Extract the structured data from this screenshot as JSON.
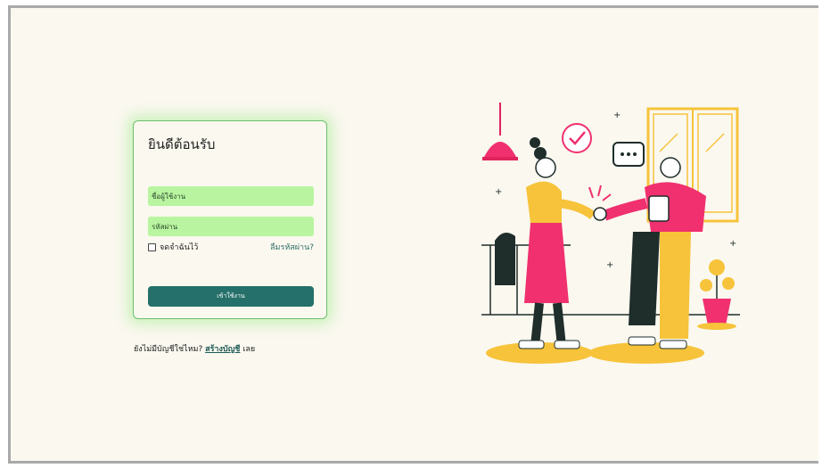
{
  "login": {
    "title": "ยินดีต้อนรับ",
    "username_placeholder": "ชื่อผู้ใช้งาน",
    "password_placeholder": "รหัสผ่าน",
    "remember_label": "จดจำฉันไว้",
    "forgot_label": "ลืมรหัสผ่าน?",
    "submit_label": "เข้าใช้งาน"
  },
  "signup": {
    "prompt": "ยังไม่มีบัญชีใช่ไหม?",
    "link_label": "สร้างบัญชี",
    "suffix": "เลย"
  },
  "colors": {
    "background": "#faf8ef",
    "field": "#b9f5a0",
    "button": "#25706a",
    "pink": "#f0306f",
    "yellow": "#f7c33b",
    "dark": "#1f2d2b"
  }
}
